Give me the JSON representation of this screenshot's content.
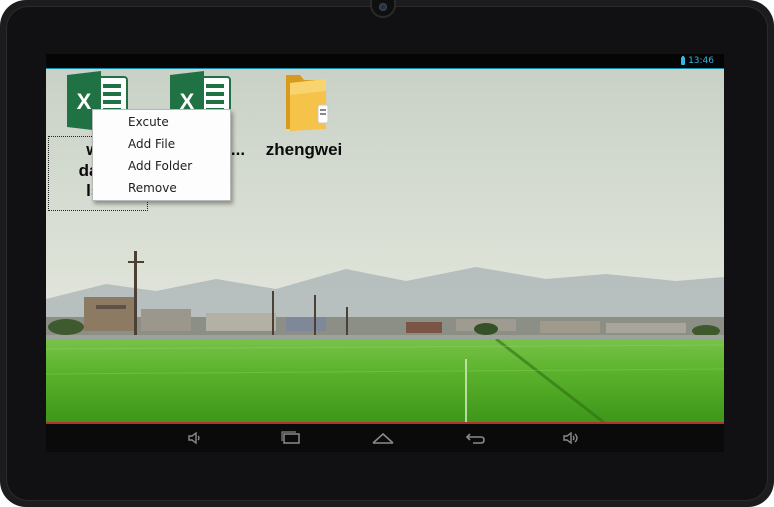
{
  "statusbar": {
    "time": "13:46",
    "battery_icon": "battery-icon"
  },
  "desktop": {
    "icons": [
      {
        "name": "excel-icon",
        "label_line1": "wo",
        "label_line2": "daily",
        "label_line3": "lsx"
      },
      {
        "name": "excel-icon",
        "label": "..."
      },
      {
        "name": "folder-icon",
        "label": "zhengwei"
      }
    ]
  },
  "context_menu": {
    "items": [
      "Excute",
      "Add File",
      "Add Folder",
      "Remove"
    ]
  },
  "navbar": {
    "buttons": [
      "volume-down-icon",
      "recent-apps-icon",
      "home-icon",
      "back-icon",
      "volume-up-icon"
    ]
  },
  "colors": {
    "accent": "#33b5e5",
    "excel_green": "#207245",
    "folder_yellow": "#f2b632"
  }
}
